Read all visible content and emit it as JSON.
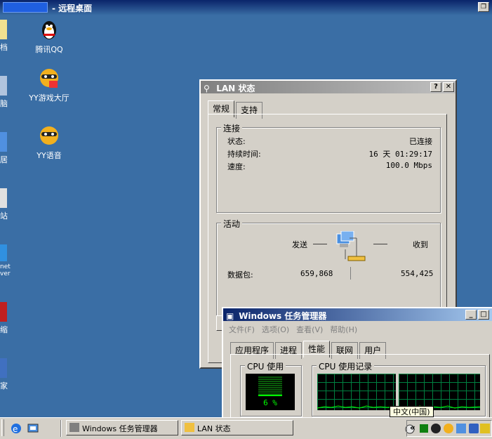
{
  "remote": {
    "title": "- 远程桌面"
  },
  "desktop": {
    "icons": [
      {
        "label": "腾讯QQ"
      },
      {
        "label": "YY游戏大厅"
      },
      {
        "label": "YY语音"
      }
    ],
    "edge_labels": [
      "档",
      "脑",
      "居",
      "站",
      "net",
      "ver",
      "缩",
      "家"
    ]
  },
  "lan": {
    "title": "LAN 状态",
    "tabs": [
      "常规",
      "支持"
    ],
    "connection": {
      "legend": "连接",
      "status_label": "状态:",
      "status_value": "已连接",
      "duration_label": "持续时间:",
      "duration_value": "16 天 01:29:17",
      "speed_label": "速度:",
      "speed_value": "100.0 Mbps"
    },
    "activity": {
      "legend": "活动",
      "sent": "发送",
      "received": "收到",
      "packets_label": "数据包:",
      "sent_value": "659,868",
      "received_value": "554,425"
    }
  },
  "taskmgr": {
    "title": "Windows 任务管理器",
    "menu": [
      "文件(F)",
      "选项(O)",
      "查看(V)",
      "帮助(H)"
    ],
    "tabs": [
      "应用程序",
      "进程",
      "性能",
      "联网",
      "用户"
    ],
    "cpu_usage_legend": "CPU 使用",
    "cpu_value": "6 %",
    "cpu_usage_percent": 6,
    "cpu_history_legend": "CPU 使用记录"
  },
  "taskbar": {
    "tasks": [
      "Windows 任务管理器",
      "LAN 状态"
    ],
    "ime_tooltip": "中文(中国)",
    "tray_chevron": "«"
  }
}
